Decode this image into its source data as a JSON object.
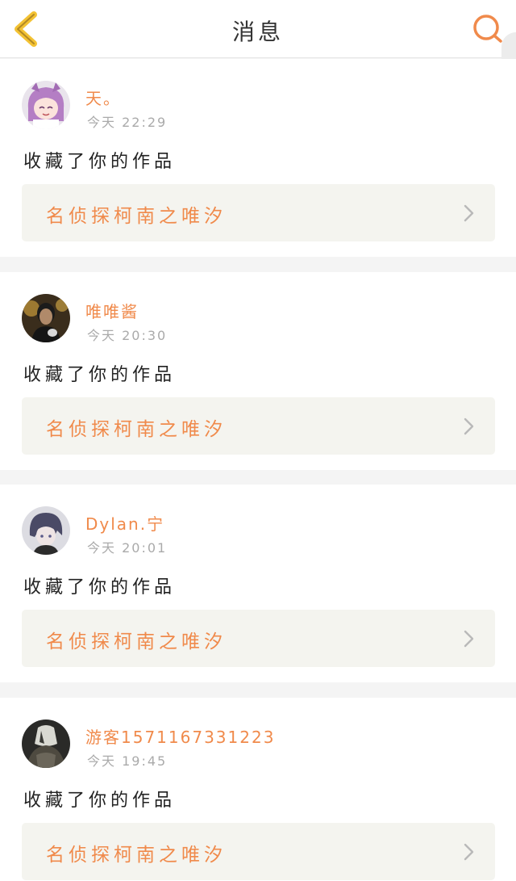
{
  "colors": {
    "accent": "#f08a4b",
    "back_arrow": "#f3c233",
    "page_bg": "#f4f4f4",
    "link_bg": "#f4f4ef",
    "time_text": "#aaaaaa"
  },
  "header": {
    "title": "消息",
    "back_icon": "chevron-left-icon",
    "search_icon": "search-icon"
  },
  "notifications": [
    {
      "username": "天。",
      "time": "今天 22:29",
      "action": "收藏了你的作品",
      "work_title": "名侦探柯南之唯汐",
      "avatar": "anime-girl-avatar"
    },
    {
      "username": "唯唯酱",
      "time": "今天 20:30",
      "action": "收藏了你的作品",
      "work_title": "名侦探柯南之唯汐",
      "avatar": "dark-portrait-avatar"
    },
    {
      "username": "Dylan.宁",
      "time": "今天 20:01",
      "action": "收藏了你的作品",
      "work_title": "名侦探柯南之唯汐",
      "avatar": "anime-boy-avatar"
    },
    {
      "username": "游客1571167331223",
      "time": "今天 19:45",
      "action": "收藏了你的作品",
      "work_title": "名侦探柯南之唯汐",
      "avatar": "dark-figure-avatar"
    }
  ]
}
